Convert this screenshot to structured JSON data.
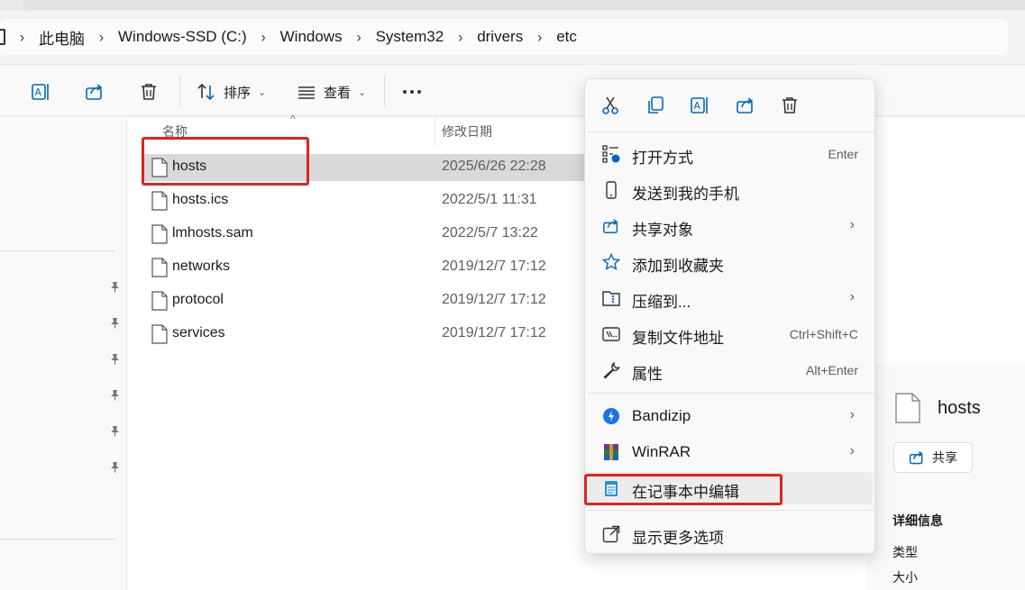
{
  "breadcrumb": [
    "此电脑",
    "Windows-SSD (C:)",
    "Windows",
    "System32",
    "drivers",
    "etc"
  ],
  "toolbar": {
    "sort_label": "排序",
    "view_label": "查看"
  },
  "columns": {
    "name": "名称",
    "modified": "修改日期"
  },
  "files": [
    {
      "name": "hosts",
      "date": "2025/6/26 22:28"
    },
    {
      "name": "hosts.ics",
      "date": "2022/5/1 11:31"
    },
    {
      "name": "lmhosts.sam",
      "date": "2022/5/7 13:22"
    },
    {
      "name": "networks",
      "date": "2019/12/7 17:12"
    },
    {
      "name": "protocol",
      "date": "2019/12/7 17:12"
    },
    {
      "name": "services",
      "date": "2019/12/7 17:12"
    }
  ],
  "context_menu": {
    "items": [
      {
        "label": "打开方式",
        "shortcut": "Enter",
        "icon": "open-with-icon"
      },
      {
        "label": "发送到我的手机",
        "shortcut": "",
        "icon": "phone-icon"
      },
      {
        "label": "共享对象",
        "shortcut": "",
        "icon": "share-icon"
      },
      {
        "label": "添加到收藏夹",
        "shortcut": "",
        "icon": "star-icon"
      },
      {
        "label": "压缩到...",
        "shortcut": "",
        "icon": "zip-icon"
      },
      {
        "label": "复制文件地址",
        "shortcut": "Ctrl+Shift+C",
        "icon": "copy-path-icon"
      },
      {
        "label": "属性",
        "shortcut": "Alt+Enter",
        "icon": "wrench-icon"
      }
    ],
    "apps": [
      {
        "label": "Bandizip",
        "icon": "bandizip-icon"
      },
      {
        "label": "WinRAR",
        "icon": "winrar-icon"
      },
      {
        "label": "在记事本中编辑",
        "icon": "notepad-icon"
      }
    ],
    "more_label": "显示更多选项"
  },
  "details": {
    "title": "hosts",
    "share_label": "共享",
    "section_label": "详细信息",
    "type_label": "类型",
    "size_label": "大小"
  },
  "colors": {
    "accent": "#0067c0",
    "highlight_box": "#e0231c",
    "selected_row": "#d9d9d9"
  }
}
